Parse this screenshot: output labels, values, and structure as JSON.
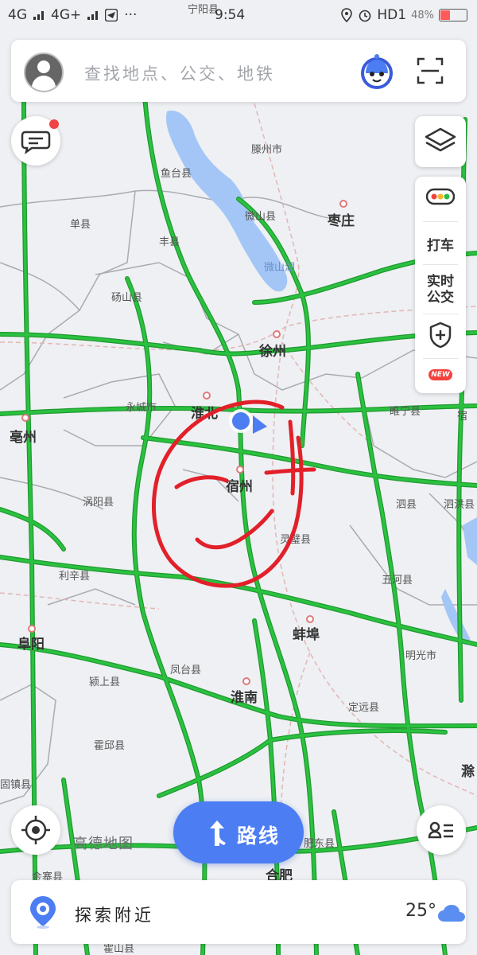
{
  "status_bar": {
    "left_signals": [
      "4G",
      "4G+"
    ],
    "time": "9:54",
    "right_network": "HD1",
    "battery": "48%"
  },
  "search": {
    "placeholder": "查找地点、公交、地铁"
  },
  "side_tools": {
    "taxi": "打车",
    "realtime_bus_1": "实时",
    "realtime_bus_2": "公交",
    "new_badge": "NEW"
  },
  "map": {
    "cities_major": [
      "徐州",
      "宿州",
      "蚌埠",
      "淮南",
      "亳州",
      "阜阳",
      "合肥",
      "枣庄",
      "淮北",
      "滁"
    ],
    "counties": [
      "鱼台县",
      "滕州市",
      "微山县",
      "单县",
      "丰县",
      "砀山县",
      "永城市",
      "睢宁县",
      "宿",
      "灵璧县",
      "涡阳县",
      "泗县",
      "泗洪县",
      "利辛县",
      "五河县",
      "明光市",
      "凤台县",
      "颍上县",
      "定远县",
      "霍邱县",
      "肥东县",
      "宁阳县",
      "金寨县",
      "霍山县",
      "固镇县"
    ],
    "lake": "微山湖",
    "colors": {
      "land": "#eef0f3",
      "highway": "#2bc140",
      "highway_outline": "#1f9a2f",
      "water": "#a3c6f7",
      "boundary": "#a8abb0",
      "rail": "#e2b6b6",
      "annotation": "#e2202a",
      "location": "#4c7df2"
    }
  },
  "route_button": {
    "label": "路线"
  },
  "brand": "高德地图",
  "bottom": {
    "explore_label": "探索附近",
    "temperature": "25°"
  },
  "icons": {
    "mascot": "mascot-icon",
    "scan": "scan-icon",
    "message": "message-icon",
    "layers": "layers-icon",
    "traffic": "traffic-light-icon",
    "safety": "shield-plus-icon",
    "locate": "locate-icon",
    "list": "list-icon",
    "route": "turn-arrow-icon",
    "explore": "explore-pin-icon",
    "weather": "cloud-icon"
  }
}
